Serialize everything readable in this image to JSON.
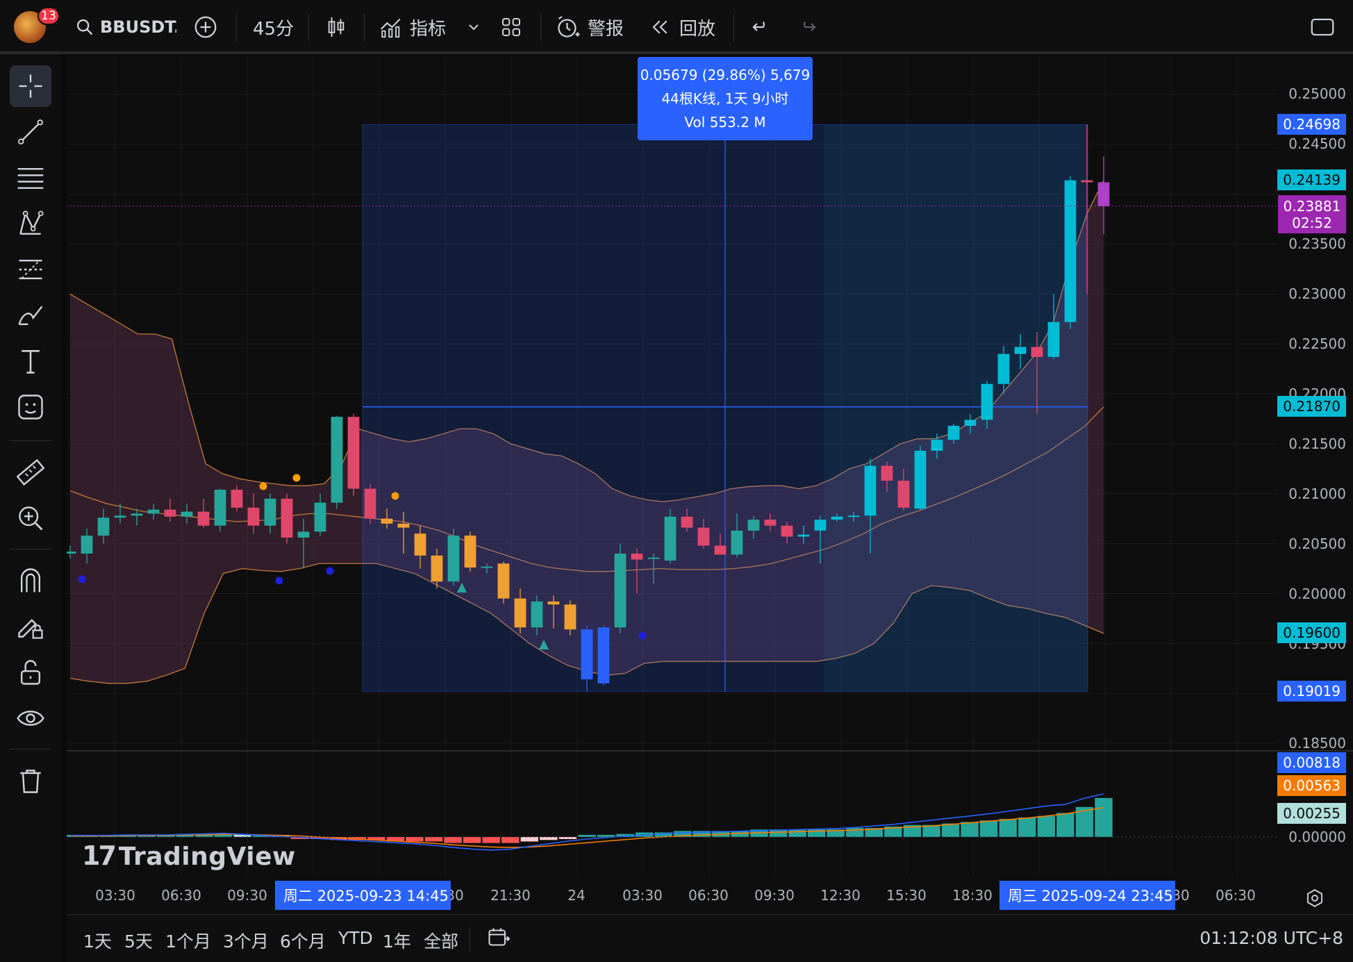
{
  "topbar": {
    "notification_count": "13",
    "symbol": "BBUSDT.I",
    "interval": "45分",
    "indicators": "指标",
    "alerts": "警报",
    "replay": "回放"
  },
  "sidebar": {
    "tools": [
      "crosshair-icon",
      "trend-line-icon",
      "horizontal-lines-icon",
      "pattern-icon",
      "fib-icon",
      "brush-icon",
      "text-icon",
      "emoji-icon",
      "ruler-icon",
      "zoom-in-icon",
      "magnet-icon",
      "lock-drawing-icon",
      "lock-icon",
      "eye-icon",
      "trash-icon"
    ]
  },
  "measure": {
    "line1": "0.05679 (29.86%) 5,679",
    "line2": "44根K线, 1天 9小时",
    "line3": "Vol 553.2 M"
  },
  "price_axis": {
    "ticks": [
      "0.25000",
      "0.24500",
      "0.23500",
      "0.23000",
      "0.22500",
      "0.22000",
      "0.21500",
      "0.21000",
      "0.20500",
      "0.20000",
      "0.19500",
      "0.18500"
    ],
    "tags": {
      "measure_high": "0.24698",
      "upper_band": "0.24139",
      "last_price": "0.23881",
      "countdown": "02:52",
      "mid_band": "0.21870",
      "lower_band": "0.19600",
      "measure_low": "0.19019"
    }
  },
  "macd_axis": {
    "macd": "0.00818",
    "signal": "0.00563",
    "hist": "0.00255",
    "zero": "0.00000"
  },
  "watermark": "TradingView",
  "time_axis": {
    "ticks": [
      "03:30",
      "06:30",
      "09:30",
      "30",
      "21:30",
      "24",
      "03:30",
      "06:30",
      "09:30",
      "12:30",
      "15:30",
      "18:30",
      "30",
      "06:30"
    ],
    "start_label": "周二 2025-09-23   14:45",
    "end_label": "周三 2025-09-24   23:45"
  },
  "bottombar": {
    "ranges": [
      "1天",
      "5天",
      "1个月",
      "3个月",
      "6个月",
      "YTD",
      "1年",
      "全部"
    ],
    "clock": "01:12:08 UTC+8"
  },
  "colors": {
    "up": "#26a69a",
    "down": "#ef5350",
    "accent": "#2962ff",
    "cyan_up": "#00bcd4",
    "orange_down": "#f0a030"
  },
  "chart_data": {
    "type": "candlestick",
    "price_range": [
      0.185,
      0.25
    ],
    "candles": [
      {
        "o": 0.204,
        "h": 0.2048,
        "l": 0.2035,
        "c": 0.2042
      },
      {
        "o": 0.204,
        "h": 0.2065,
        "l": 0.203,
        "c": 0.2058
      },
      {
        "o": 0.2058,
        "h": 0.2085,
        "l": 0.205,
        "c": 0.2076
      },
      {
        "o": 0.2076,
        "h": 0.209,
        "l": 0.207,
        "c": 0.2078
      },
      {
        "o": 0.2078,
        "h": 0.2085,
        "l": 0.2068,
        "c": 0.208
      },
      {
        "o": 0.208,
        "h": 0.209,
        "l": 0.2074,
        "c": 0.2084
      },
      {
        "o": 0.2084,
        "h": 0.2095,
        "l": 0.2072,
        "c": 0.2077
      },
      {
        "o": 0.2077,
        "h": 0.209,
        "l": 0.207,
        "c": 0.2082
      },
      {
        "o": 0.2082,
        "h": 0.2095,
        "l": 0.2066,
        "c": 0.2068
      },
      {
        "o": 0.2068,
        "h": 0.2105,
        "l": 0.2062,
        "c": 0.2104
      },
      {
        "o": 0.2104,
        "h": 0.2108,
        "l": 0.2082,
        "c": 0.2086
      },
      {
        "o": 0.2086,
        "h": 0.21,
        "l": 0.206,
        "c": 0.2068
      },
      {
        "o": 0.2068,
        "h": 0.21,
        "l": 0.206,
        "c": 0.2095
      },
      {
        "o": 0.2095,
        "h": 0.21,
        "l": 0.205,
        "c": 0.2056
      },
      {
        "o": 0.2056,
        "h": 0.2075,
        "l": 0.2025,
        "c": 0.2062
      },
      {
        "o": 0.2062,
        "h": 0.21,
        "l": 0.2058,
        "c": 0.2091
      },
      {
        "o": 0.2091,
        "h": 0.2178,
        "l": 0.2085,
        "c": 0.2177
      },
      {
        "o": 0.2177,
        "h": 0.218,
        "l": 0.2098,
        "c": 0.2105
      },
      {
        "o": 0.2105,
        "h": 0.211,
        "l": 0.207,
        "c": 0.2075
      },
      {
        "o": 0.2075,
        "h": 0.2085,
        "l": 0.2065,
        "c": 0.207
      },
      {
        "o": 0.207,
        "h": 0.2082,
        "l": 0.204,
        "c": 0.2066
      },
      {
        "o": 0.206,
        "h": 0.2068,
        "l": 0.2025,
        "c": 0.2038
      },
      {
        "o": 0.2038,
        "h": 0.2045,
        "l": 0.2005,
        "c": 0.2012
      },
      {
        "o": 0.2012,
        "h": 0.2065,
        "l": 0.2008,
        "c": 0.2058
      },
      {
        "o": 0.2058,
        "h": 0.2062,
        "l": 0.2022,
        "c": 0.2026
      },
      {
        "o": 0.2026,
        "h": 0.203,
        "l": 0.202,
        "c": 0.2027
      },
      {
        "o": 0.203,
        "h": 0.2032,
        "l": 0.199,
        "c": 0.1995
      },
      {
        "o": 0.1995,
        "h": 0.2005,
        "l": 0.196,
        "c": 0.1966
      },
      {
        "o": 0.1966,
        "h": 0.1998,
        "l": 0.1958,
        "c": 0.1992
      },
      {
        "o": 0.1992,
        "h": 0.1998,
        "l": 0.1965,
        "c": 0.1989
      },
      {
        "o": 0.1989,
        "h": 0.1993,
        "l": 0.1958,
        "c": 0.1964
      },
      {
        "o": 0.1964,
        "h": 0.1968,
        "l": 0.1902,
        "c": 0.1914
      },
      {
        "o": 0.191,
        "h": 0.1968,
        "l": 0.1908,
        "c": 0.1966
      },
      {
        "o": 0.1966,
        "h": 0.205,
        "l": 0.196,
        "c": 0.204
      },
      {
        "o": 0.204,
        "h": 0.2045,
        "l": 0.2,
        "c": 0.2034
      },
      {
        "o": 0.2035,
        "h": 0.204,
        "l": 0.201,
        "c": 0.2036
      },
      {
        "o": 0.2033,
        "h": 0.2085,
        "l": 0.203,
        "c": 0.2077
      },
      {
        "o": 0.2077,
        "h": 0.2085,
        "l": 0.2062,
        "c": 0.2066
      },
      {
        "o": 0.2066,
        "h": 0.2075,
        "l": 0.2045,
        "c": 0.2048
      },
      {
        "o": 0.2048,
        "h": 0.206,
        "l": 0.204,
        "c": 0.2039
      },
      {
        "o": 0.2039,
        "h": 0.208,
        "l": 0.2036,
        "c": 0.2063
      },
      {
        "o": 0.2063,
        "h": 0.2078,
        "l": 0.2055,
        "c": 0.2074
      },
      {
        "o": 0.2074,
        "h": 0.208,
        "l": 0.2062,
        "c": 0.2068
      },
      {
        "o": 0.2068,
        "h": 0.2072,
        "l": 0.205,
        "c": 0.2057
      },
      {
        "o": 0.2057,
        "h": 0.2068,
        "l": 0.205,
        "c": 0.2059
      },
      {
        "o": 0.2063,
        "h": 0.2078,
        "l": 0.203,
        "c": 0.2074
      },
      {
        "o": 0.2074,
        "h": 0.208,
        "l": 0.2072,
        "c": 0.2077
      },
      {
        "o": 0.2077,
        "h": 0.2082,
        "l": 0.2072,
        "c": 0.2078
      },
      {
        "o": 0.2078,
        "h": 0.2135,
        "l": 0.204,
        "c": 0.2128
      },
      {
        "o": 0.2128,
        "h": 0.2132,
        "l": 0.2102,
        "c": 0.2113
      },
      {
        "o": 0.2113,
        "h": 0.2125,
        "l": 0.2083,
        "c": 0.2086
      },
      {
        "o": 0.2085,
        "h": 0.2148,
        "l": 0.2084,
        "c": 0.2143
      },
      {
        "o": 0.2143,
        "h": 0.216,
        "l": 0.2135,
        "c": 0.2154
      },
      {
        "o": 0.2154,
        "h": 0.217,
        "l": 0.215,
        "c": 0.2168
      },
      {
        "o": 0.2168,
        "h": 0.218,
        "l": 0.216,
        "c": 0.2174
      },
      {
        "o": 0.2174,
        "h": 0.2213,
        "l": 0.2165,
        "c": 0.221
      },
      {
        "o": 0.221,
        "h": 0.2248,
        "l": 0.22,
        "c": 0.224
      },
      {
        "o": 0.224,
        "h": 0.226,
        "l": 0.2225,
        "c": 0.2247
      },
      {
        "o": 0.2247,
        "h": 0.2262,
        "l": 0.218,
        "c": 0.2237
      },
      {
        "o": 0.2237,
        "h": 0.23,
        "l": 0.2235,
        "c": 0.2272
      },
      {
        "o": 0.2272,
        "h": 0.2418,
        "l": 0.2265,
        "c": 0.2414
      },
      {
        "o": 0.2414,
        "h": 0.247,
        "l": 0.23,
        "c": 0.2412
      },
      {
        "o": 0.2412,
        "h": 0.2438,
        "l": 0.236,
        "c": 0.2388
      }
    ],
    "bollinger_upper": [
      0.23,
      0.229,
      0.228,
      0.227,
      0.226,
      0.226,
      0.2255,
      0.219,
      0.213,
      0.212,
      0.2115,
      0.2112,
      0.211,
      0.2108,
      0.2108,
      0.211,
      0.2128,
      0.2165,
      0.216,
      0.2155,
      0.2152,
      0.2155,
      0.216,
      0.2165,
      0.2165,
      0.216,
      0.215,
      0.2145,
      0.214,
      0.2138,
      0.213,
      0.212,
      0.2105,
      0.2098,
      0.2094,
      0.2092,
      0.2094,
      0.2097,
      0.21,
      0.2105,
      0.2107,
      0.2108,
      0.2108,
      0.2105,
      0.2108,
      0.2115,
      0.2125,
      0.213,
      0.214,
      0.215,
      0.2155,
      0.2155,
      0.216,
      0.217,
      0.218,
      0.22,
      0.222,
      0.224,
      0.227,
      0.233,
      0.238,
      0.2414
    ],
    "bollinger_mid": [
      0.2103,
      0.2096,
      0.209,
      0.2086,
      0.2082,
      0.208,
      0.2078,
      0.2076,
      0.2074,
      0.2072,
      0.2073,
      0.2074,
      0.2078,
      0.208,
      0.208,
      0.2078,
      0.2076,
      0.2074,
      0.2072,
      0.2068,
      0.2063,
      0.2056,
      0.2048,
      0.2042,
      0.2036,
      0.203,
      0.2026,
      0.2024,
      0.2022,
      0.2022,
      0.2023,
      0.2024,
      0.2025,
      0.2024,
      0.2024,
      0.2024,
      0.2025,
      0.2027,
      0.203,
      0.2035,
      0.204,
      0.2045,
      0.2052,
      0.206,
      0.207,
      0.2077,
      0.2083,
      0.209,
      0.2097,
      0.2105,
      0.2113,
      0.2122,
      0.2132,
      0.2142,
      0.2155,
      0.2168,
      0.2187
    ],
    "bollinger_lower": [
      0.1915,
      0.1912,
      0.191,
      0.191,
      0.1912,
      0.1918,
      0.1925,
      0.198,
      0.202,
      0.2025,
      0.2023,
      0.2022,
      0.2025,
      0.203,
      0.203,
      0.203,
      0.203,
      0.2025,
      0.202,
      0.201,
      0.2,
      0.199,
      0.198,
      0.1965,
      0.195,
      0.1938,
      0.1928,
      0.1922,
      0.1918,
      0.192,
      0.193,
      0.1932,
      0.1932,
      0.1932,
      0.1932,
      0.1932,
      0.1932,
      0.1932,
      0.1932,
      0.1932,
      0.1935,
      0.194,
      0.195,
      0.197,
      0.2,
      0.2008,
      0.2006,
      0.2003,
      0.1995,
      0.1988,
      0.1985,
      0.198,
      0.1976,
      0.1968,
      0.196
    ],
    "measure_range": [
      0.19019,
      0.24698
    ],
    "last_price": 0.23881,
    "macd": [
      0.0003,
      0.0003,
      0.0003,
      0.0004,
      0.0004,
      0.0004,
      0.0005,
      0.0006,
      0.0007,
      0.0005,
      0.0003,
      0.0001,
      -0.0001,
      -0.0003,
      -0.0005,
      -0.0007,
      -0.0009,
      -0.0011,
      -0.0013,
      -0.0016,
      -0.002,
      -0.0023,
      -0.0025,
      -0.0023,
      -0.0018,
      -0.0013,
      -0.0008,
      -0.0004,
      -0.0001,
      0.0002,
      0.0004,
      0.0006,
      0.0008,
      0.0009,
      0.001,
      0.0011,
      0.0012,
      0.0013,
      0.0014,
      0.0015,
      0.0016,
      0.0018,
      0.0021,
      0.0024,
      0.0028,
      0.0032,
      0.0036,
      0.004,
      0.0044,
      0.0049,
      0.0054,
      0.0059,
      0.0062,
      0.0074,
      0.0082
    ],
    "signal": [
      0.0002,
      0.0002,
      0.0002,
      0.0003,
      0.0003,
      0.0003,
      0.0004,
      0.0004,
      0.0005,
      0.0005,
      0.0004,
      0.0003,
      0.0002,
      0.0,
      -0.0002,
      -0.0004,
      -0.0006,
      -0.0008,
      -0.001,
      -0.0012,
      -0.0015,
      -0.0017,
      -0.0019,
      -0.002,
      -0.0019,
      -0.0017,
      -0.0014,
      -0.0011,
      -0.0008,
      -0.0005,
      -0.0002,
      0.0,
      0.0002,
      0.0004,
      0.0005,
      0.0007,
      0.0008,
      0.0009,
      0.001,
      0.0011,
      0.0012,
      0.0013,
      0.0015,
      0.0017,
      0.0019,
      0.0021,
      0.0024,
      0.0027,
      0.003,
      0.0033,
      0.0036,
      0.004,
      0.0044,
      0.005,
      0.0056
    ],
    "hist": [
      0.0001,
      0.0001,
      0.0001,
      0.0001,
      0.0001,
      0.0001,
      0.0001,
      0.0002,
      0.0002,
      0.0001,
      0.0001,
      0.0,
      -0.0001,
      -0.0001,
      -0.0002,
      -0.0002,
      -0.0002,
      -0.0003,
      -0.0003,
      -0.0003,
      -0.0004,
      -0.0004,
      -0.0004,
      -0.0004,
      -0.0003,
      -0.0002,
      -0.0001,
      0.0,
      0.0001,
      0.0002,
      0.0003,
      0.0003,
      0.0004,
      0.0004,
      0.0004,
      0.0004,
      0.0005,
      0.0005,
      0.0005,
      0.0005,
      0.0005,
      0.0006,
      0.0006,
      0.0007,
      0.0008,
      0.0008,
      0.0009,
      0.001,
      0.0011,
      0.0012,
      0.0013,
      0.0014,
      0.0016,
      0.002,
      0.0026
    ]
  }
}
